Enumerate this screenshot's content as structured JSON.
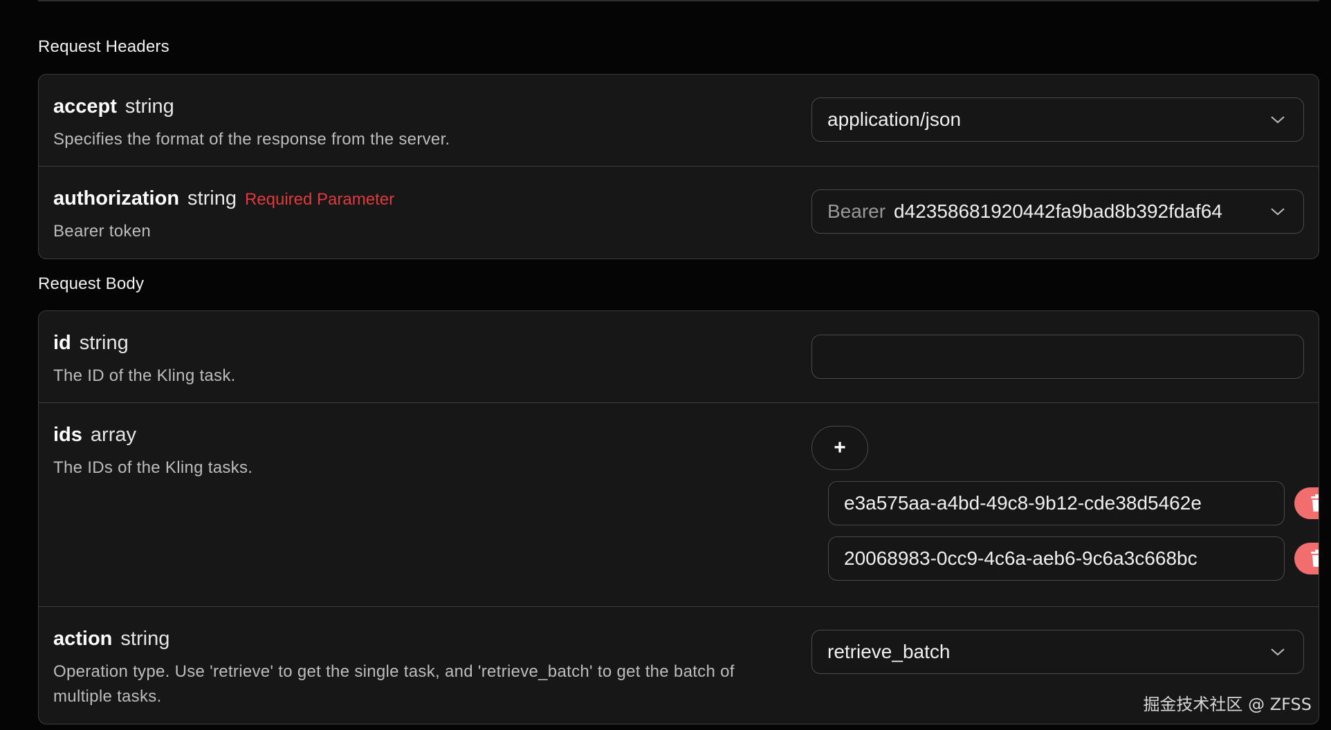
{
  "headers_section": {
    "title": "Request Headers",
    "params": [
      {
        "name": "accept",
        "type": "string",
        "description": "Specifies the format of the response from the server.",
        "value": "application/json"
      },
      {
        "name": "authorization",
        "type": "string",
        "required_label": "Required Parameter",
        "description": "Bearer token",
        "value_prefix": "Bearer",
        "value": "d42358681920442fa9bad8b392fdaf64"
      }
    ]
  },
  "body_section": {
    "title": "Request Body",
    "params": [
      {
        "name": "id",
        "type": "string",
        "description": "The ID of the Kling task.",
        "value": ""
      },
      {
        "name": "ids",
        "type": "array",
        "description": "The IDs of the Kling tasks.",
        "add_label": "+",
        "items": [
          "e3a575aa-a4bd-49c8-9b12-cde38d5462e",
          "20068983-0cc9-4c6a-aeb6-9c6a3c668bc"
        ]
      },
      {
        "name": "action",
        "type": "string",
        "description": "Operation type. Use 'retrieve' to get the single task, and 'retrieve_batch' to get the batch of multiple tasks.",
        "value": "retrieve_batch"
      }
    ]
  },
  "watermark": "掘金技术社区 @ ZFSS",
  "colors": {
    "background": "#050505",
    "card": "#171717",
    "border": "#3d3d3d",
    "required": "#e0393e",
    "delete": "#f26d6d"
  },
  "icons": {
    "dropdown": "chevron-down-icon",
    "delete": "trash-icon",
    "add": "plus-icon"
  }
}
